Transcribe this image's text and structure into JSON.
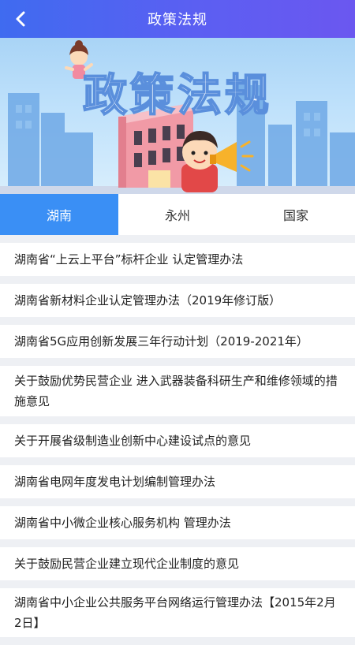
{
  "header": {
    "title": "政策法规"
  },
  "banner": {
    "text": "政策法规"
  },
  "tabs": [
    {
      "label": "湖南",
      "active": true
    },
    {
      "label": "永州",
      "active": false
    },
    {
      "label": "国家",
      "active": false
    }
  ],
  "list": [
    "湖南省“上云上平台”标杆企业 认定管理办法",
    "湖南省新材料企业认定管理办法（2019年修订版）",
    "湖南省5G应用创新发展三年行动计划（2019-2021年）",
    "关于鼓励优势民营企业 进入武器装备科研生产和维修领域的措施意见",
    "关于开展省级制造业创新中心建设试点的意见",
    "湖南省电网年度发电计划编制管理办法",
    "湖南省中小微企业核心服务机构 管理办法",
    "关于鼓励民营企业建立现代企业制度的意见",
    "湖南省中小企业公共服务平台网络运行管理办法【2015年2月2日】"
  ],
  "colors": {
    "header": "#4f63f1",
    "tab_active": "#3a8ff5",
    "list_bg": "#eef0f4"
  },
  "icons": {
    "back": "chevron-left-icon"
  }
}
